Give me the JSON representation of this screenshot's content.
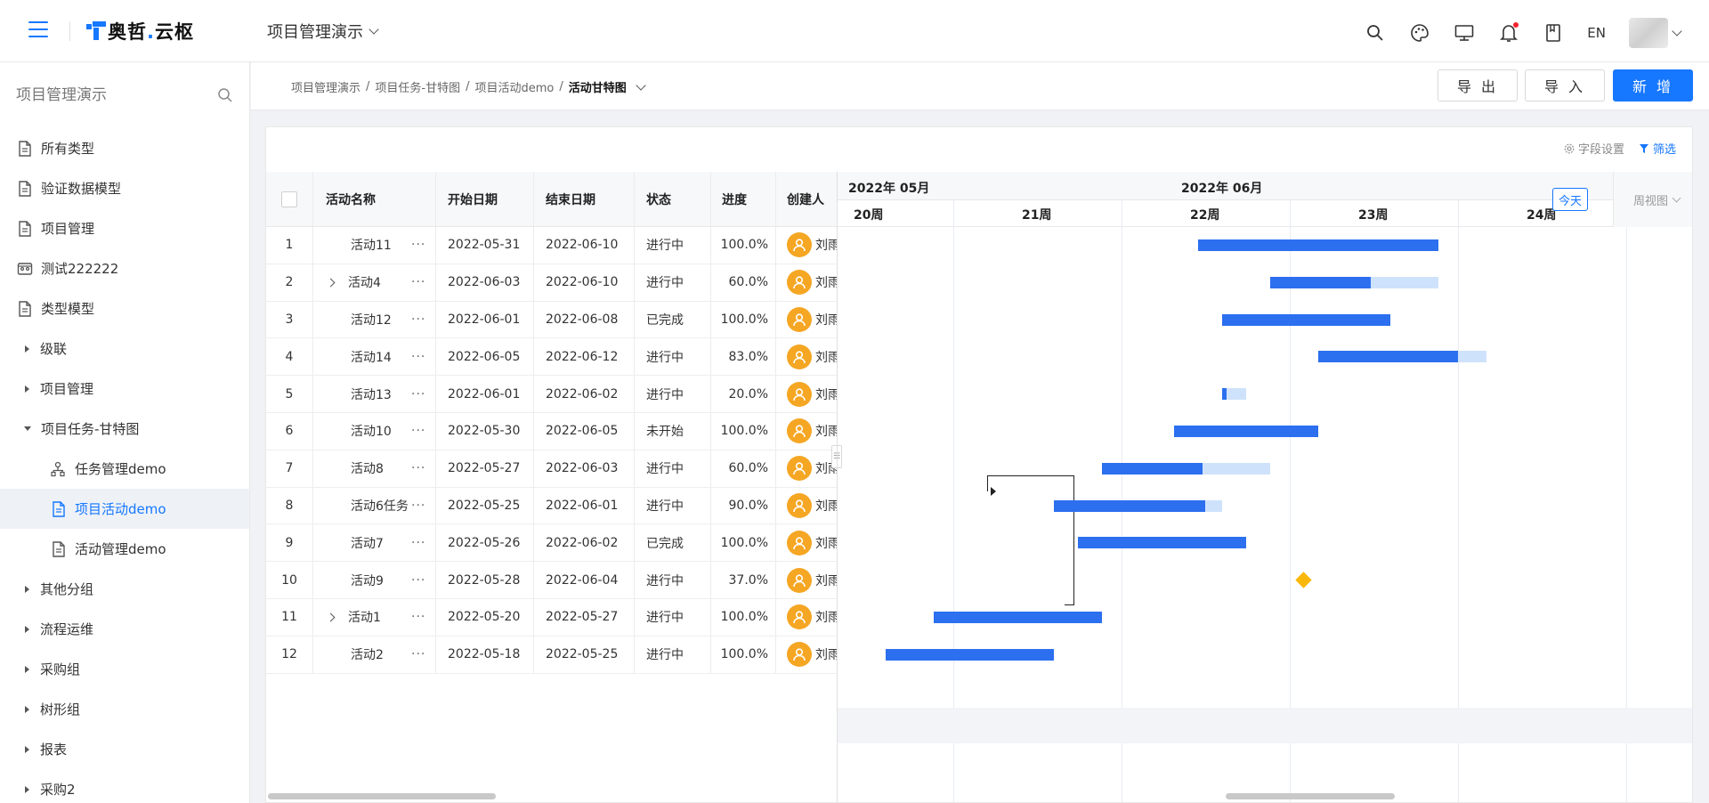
{
  "header": {
    "logo_brand": "奥哲",
    "logo_dot": ".",
    "logo_product": "云枢",
    "project_name": "项目管理演示",
    "lang": "EN",
    "icons": [
      "search-icon",
      "palette-icon",
      "monitor-icon",
      "bell-icon",
      "book-icon"
    ]
  },
  "sidebar": {
    "search_placeholder": "项目管理演示",
    "items": [
      {
        "label": "所有类型",
        "icon": "document-icon",
        "level": 0
      },
      {
        "label": "验证数据模型",
        "icon": "document-icon",
        "level": 0
      },
      {
        "label": "项目管理",
        "icon": "document-icon",
        "level": 0
      },
      {
        "label": "测试222222",
        "icon": "dashboard-icon",
        "level": 0
      },
      {
        "label": "类型模型",
        "icon": "document-icon",
        "level": 0
      },
      {
        "label": "级联",
        "icon": "caret-right-icon",
        "level": 0
      },
      {
        "label": "项目管理",
        "icon": "caret-right-icon",
        "level": 0
      },
      {
        "label": "项目任务-甘特图",
        "icon": "caret-down-icon",
        "level": 0
      },
      {
        "label": "任务管理demo",
        "icon": "org-icon",
        "level": 1
      },
      {
        "label": "项目活动demo",
        "icon": "document-icon",
        "level": 1,
        "active": true
      },
      {
        "label": "活动管理demo",
        "icon": "document-icon",
        "level": 1
      },
      {
        "label": "其他分组",
        "icon": "caret-right-icon",
        "level": 0
      },
      {
        "label": "流程运维",
        "icon": "caret-right-icon",
        "level": 0
      },
      {
        "label": "采购组",
        "icon": "caret-right-icon",
        "level": 0
      },
      {
        "label": "树形组",
        "icon": "caret-right-icon",
        "level": 0
      },
      {
        "label": "报表",
        "icon": "caret-right-icon",
        "level": 0
      },
      {
        "label": "采购2",
        "icon": "caret-right-icon",
        "level": 0
      }
    ]
  },
  "toolbar": {
    "breadcrumb": [
      "项目管理演示",
      "项目任务-甘特图",
      "项目活动demo",
      "活动甘特图"
    ],
    "sep": "/",
    "export_label": "导 出",
    "import_label": "导 入",
    "new_label": "新 增"
  },
  "card": {
    "field_settings": "字段设置",
    "filter": "筛选"
  },
  "table": {
    "columns": [
      "",
      "活动名称",
      "开始日期",
      "结束日期",
      "状态",
      "进度",
      "创建人"
    ],
    "more": "···",
    "rows": [
      {
        "idx": "1",
        "name": "活动11",
        "start": "2022-05-31",
        "end": "2022-06-10",
        "status": "进行中",
        "progress": "100.0%",
        "creator": "刘雨",
        "expand": false
      },
      {
        "idx": "2",
        "name": "活动4",
        "start": "2022-06-03",
        "end": "2022-06-10",
        "status": "进行中",
        "progress": "60.0%",
        "creator": "刘雨",
        "expand": true
      },
      {
        "idx": "3",
        "name": "活动12",
        "start": "2022-06-01",
        "end": "2022-06-08",
        "status": "已完成",
        "progress": "100.0%",
        "creator": "刘雨",
        "expand": false
      },
      {
        "idx": "4",
        "name": "活动14",
        "start": "2022-06-05",
        "end": "2022-06-12",
        "status": "进行中",
        "progress": "83.0%",
        "creator": "刘雨",
        "expand": false
      },
      {
        "idx": "5",
        "name": "活动13",
        "start": "2022-06-01",
        "end": "2022-06-02",
        "status": "进行中",
        "progress": "20.0%",
        "creator": "刘雨",
        "expand": false
      },
      {
        "idx": "6",
        "name": "活动10",
        "start": "2022-05-30",
        "end": "2022-06-05",
        "status": "未开始",
        "progress": "100.0%",
        "creator": "刘雨",
        "expand": false
      },
      {
        "idx": "7",
        "name": "活动8",
        "start": "2022-05-27",
        "end": "2022-06-03",
        "status": "进行中",
        "progress": "60.0%",
        "creator": "刘雨",
        "expand": false
      },
      {
        "idx": "8",
        "name": "活动6任务",
        "start": "2022-05-25",
        "end": "2022-06-01",
        "status": "进行中",
        "progress": "90.0%",
        "creator": "刘雨",
        "expand": false
      },
      {
        "idx": "9",
        "name": "活动7",
        "start": "2022-05-26",
        "end": "2022-06-02",
        "status": "已完成",
        "progress": "100.0%",
        "creator": "刘雨",
        "expand": false
      },
      {
        "idx": "10",
        "name": "活动9",
        "start": "2022-05-28",
        "end": "2022-06-04",
        "status": "进行中",
        "progress": "37.0%",
        "creator": "刘雨",
        "expand": false
      },
      {
        "idx": "11",
        "name": "活动1",
        "start": "2022-05-20",
        "end": "2022-05-27",
        "status": "进行中",
        "progress": "100.0%",
        "creator": "刘雨",
        "expand": true
      },
      {
        "idx": "12",
        "name": "活动2",
        "start": "2022-05-18",
        "end": "2022-05-25",
        "status": "进行中",
        "progress": "100.0%",
        "creator": "刘雨",
        "expand": false
      }
    ]
  },
  "gantt": {
    "months": [
      "2022年 05月",
      "2022年 06月"
    ],
    "weeks": [
      "20周",
      "21周",
      "22周",
      "23周",
      "24周"
    ],
    "today_label": "今天",
    "view_label": "周视图",
    "colors": {
      "fill": "#2c6fef",
      "remaining": "#cfe2fb",
      "milestone": "#fab80a"
    },
    "bars": [
      {
        "start": "2022-05-31",
        "end": "2022-06-10",
        "progress": 1.0
      },
      {
        "start": "2022-06-03",
        "end": "2022-06-10",
        "progress": 0.6
      },
      {
        "start": "2022-06-01",
        "end": "2022-06-08",
        "progress": 1.0
      },
      {
        "start": "2022-06-05",
        "end": "2022-06-12",
        "progress": 0.83
      },
      {
        "start": "2022-06-01",
        "end": "2022-06-02",
        "progress": 0.2
      },
      {
        "start": "2022-05-30",
        "end": "2022-06-05",
        "progress": 1.0
      },
      {
        "start": "2022-05-27",
        "end": "2022-06-03",
        "progress": 0.6
      },
      {
        "start": "2022-05-25",
        "end": "2022-06-01",
        "progress": 0.9
      },
      {
        "start": "2022-05-26",
        "end": "2022-06-02",
        "progress": 1.0
      },
      {
        "start": "2022-06-04",
        "end": "2022-06-04",
        "progress": 0.37,
        "milestone": true
      },
      {
        "start": "2022-05-20",
        "end": "2022-05-27",
        "progress": 1.0
      },
      {
        "start": "2022-05-18",
        "end": "2022-05-25",
        "progress": 1.0
      }
    ]
  }
}
